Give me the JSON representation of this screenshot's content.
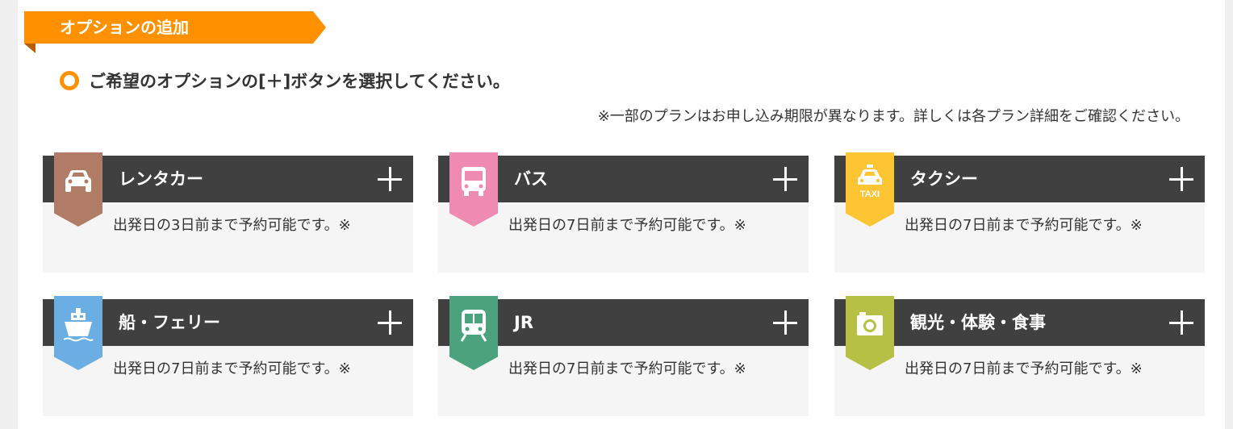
{
  "section": {
    "title": "オプションの追加",
    "instruction": "ご希望のオプションの[＋]ボタンを選択してください。",
    "note": "※一部のプランはお申し込み期限が異なります。詳しくは各プラン詳細をご確認ください。"
  },
  "colors": {
    "accent": "#ff9100",
    "header_bg": "#404040",
    "card_bg": "#f5f5f5"
  },
  "options": [
    {
      "title": "レンタカー",
      "description": "出発日の3日前まで予約可能です。※",
      "icon": "car-icon",
      "color": "#b07c65"
    },
    {
      "title": "バス",
      "description": "出発日の7日前まで予約可能です。※",
      "icon": "bus-icon",
      "color": "#ef8bb2"
    },
    {
      "title": "タクシー",
      "description": "出発日の7日前まで予約可能です。※",
      "icon": "taxi-icon",
      "icon_text": "TAXI",
      "color": "#fdc433"
    },
    {
      "title": "船・フェリー",
      "description": "出発日の7日前まで予約可能です。※",
      "icon": "ship-icon",
      "color": "#6aaee3"
    },
    {
      "title": "JR",
      "description": "出発日の7日前まで予約可能です。※",
      "icon": "train-icon",
      "color": "#4aa37c"
    },
    {
      "title": "観光・体験・食事",
      "description": "出発日の7日前まで予約可能です。※",
      "icon": "camera-icon",
      "color": "#b5c044"
    }
  ]
}
